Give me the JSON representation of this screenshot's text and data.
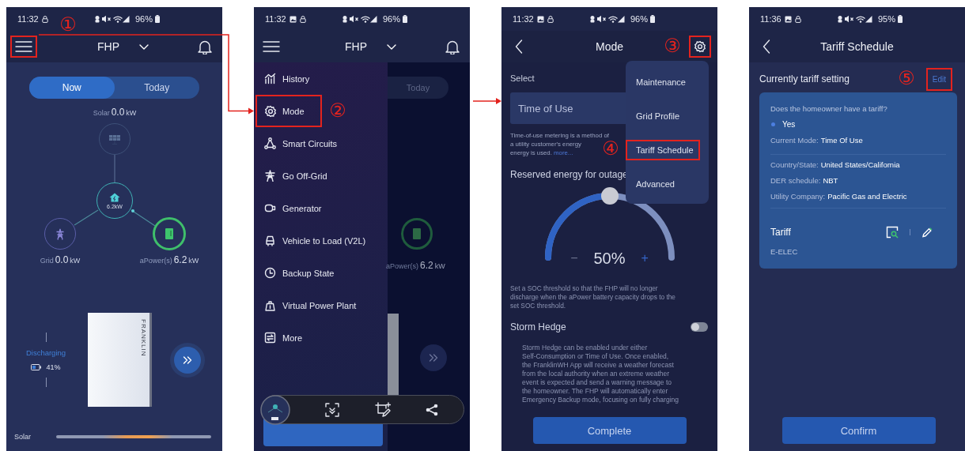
{
  "home_screen": {
    "status": {
      "time": "11:32",
      "battery": "96%"
    },
    "header": {
      "title": "FHP",
      "menu_highlighted": true
    },
    "segments": [
      {
        "label": "Now",
        "selected": true
      },
      {
        "label": "Today",
        "selected": false
      }
    ],
    "flow": {
      "solar": {
        "label": "Solar",
        "value": "0.0",
        "unit": "kW"
      },
      "home": {
        "value": "6.2kW"
      },
      "grid": {
        "label": "Grid",
        "value": "0.0",
        "unit": "kW"
      },
      "apower": {
        "label": "aPower(s)",
        "value": "6.2",
        "unit": "kW"
      }
    },
    "battery": {
      "status": "Discharging",
      "percent": "41%",
      "brand": "FRANKLIN"
    },
    "bars": [
      {
        "label": "Solar"
      }
    ]
  },
  "menu_screen": {
    "status": {
      "time": "11:32",
      "battery": "96%"
    },
    "header": {
      "title": "FHP"
    },
    "drawer": [
      {
        "label": "History",
        "highlighted": false
      },
      {
        "label": "Mode",
        "highlighted": true
      },
      {
        "label": "Smart Circuits",
        "highlighted": false
      },
      {
        "label": "Go Off-Grid",
        "highlighted": false
      },
      {
        "label": "Generator",
        "highlighted": false
      },
      {
        "label": "Vehicle to Load (V2L)",
        "highlighted": false
      },
      {
        "label": "Backup State",
        "highlighted": false
      },
      {
        "label": "Virtual Power Plant",
        "highlighted": false
      },
      {
        "label": "More",
        "highlighted": false
      }
    ],
    "behind": {
      "segment": "Today",
      "apower_label": "aPower(s)",
      "apower_value": "6.2",
      "apower_unit": "kW"
    }
  },
  "mode_screen": {
    "status": {
      "time": "11:32",
      "battery": "96%"
    },
    "header": {
      "title": "Mode",
      "settings_highlighted": true
    },
    "select_label": "Select",
    "select_value": "Time of Use",
    "description": [
      "Time-of-use metering is a method of",
      "a utility customer's energy",
      "energy is used."
    ],
    "more_link": "more...",
    "reserve": {
      "title": "Reserved energy for outage",
      "level": 0.5,
      "reading": "50%",
      "minus": "−",
      "plus": "+"
    },
    "soc_note": [
      "Set a SOC threshold so that the FHP will no longer",
      "discharge when the aPower battery capacity drops to the",
      "set SOC threshold."
    ],
    "storm": {
      "title": "Storm Hedge",
      "on": false,
      "text": [
        "Storm Hedge can be enabled under either",
        "Self-Consumption or Time of Use. Once enabled,",
        "the FranklinWH App will receive a weather forecast",
        "from the local authority when an extreme weather",
        "event is expected and send a warning message to",
        "the homeowner. The FHP will automatically enter",
        "Emergency Backup mode, focusing on fully charging"
      ]
    },
    "button": "Complete",
    "menu": [
      {
        "label": "Maintenance",
        "highlighted": false
      },
      {
        "label": "Grid Profile",
        "highlighted": false
      },
      {
        "label": "Tariff Schedule",
        "highlighted": true
      },
      {
        "label": "Advanced",
        "highlighted": false
      }
    ]
  },
  "tariff_screen": {
    "status": {
      "time": "11:36",
      "battery": "95%"
    },
    "header": {
      "title": "Tariff Schedule"
    },
    "section": "Currently tariff setting",
    "edit": {
      "label": "Edit",
      "highlighted": true
    },
    "question": "Does the homeowner have a tariff?",
    "answer": "Yes",
    "fields": [
      {
        "label": "Current Mode:",
        "value": "Time Of Use"
      }
    ],
    "fields2": [
      {
        "label": "Country/State:",
        "value": "United States/California"
      },
      {
        "label": "DER schedule:",
        "value": "NBT"
      },
      {
        "label": "Utility Company:",
        "value": "Pacific Gas and Electric"
      }
    ],
    "tariff": {
      "title": "Tariff",
      "value": "E-ELEC"
    },
    "button": "Confirm"
  },
  "steps": [
    "①",
    "②",
    "③",
    "④",
    "⑤"
  ]
}
